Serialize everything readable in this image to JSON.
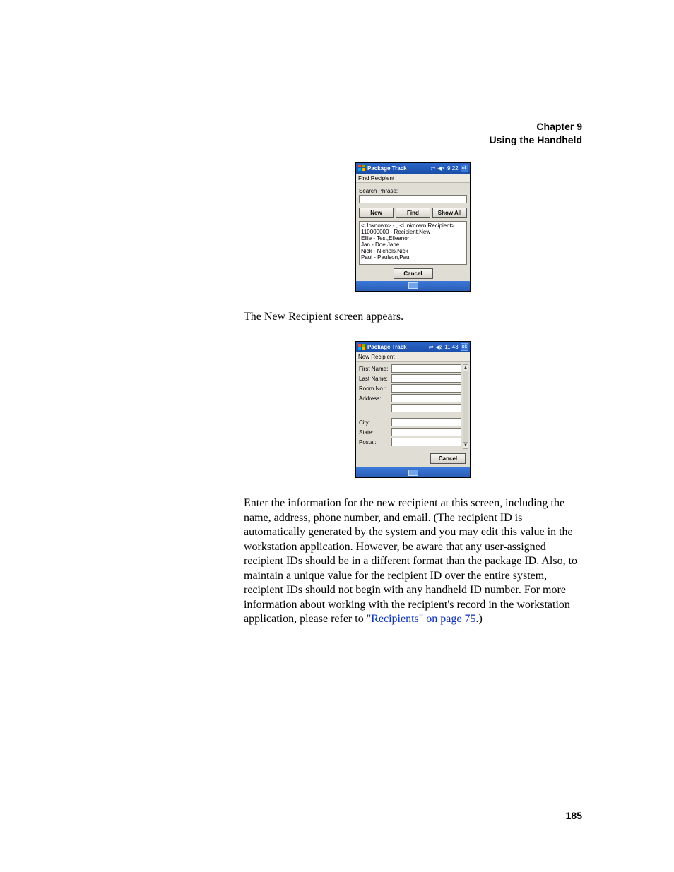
{
  "header": {
    "chapter": "Chapter 9",
    "title": "Using the Handheld"
  },
  "device1": {
    "titlebar": {
      "app": "Package Track",
      "time": "9:22",
      "ok": "ok"
    },
    "subhead": "Find Recipient",
    "search_label": "Search Phrase:",
    "buttons": {
      "new": "New",
      "find": "Find",
      "showall": "Show All"
    },
    "results": [
      "<Unknown> - , <Unknown Recipient>",
      "110000000 - Recipient,New",
      "Ellie - Test,Elleanor",
      "Jan - Doe,Jane",
      "Nick - Nichols,Nick",
      "Paul - Paulson,Paul"
    ],
    "cancel": "Cancel"
  },
  "caption1": "The New Recipient screen appears.",
  "device2": {
    "titlebar": {
      "app": "Package Track",
      "time": "11:43",
      "ok": "ok"
    },
    "subhead": "New Recipient",
    "fields": {
      "first": "First Name:",
      "last": "Last Name:",
      "room": "Room No.:",
      "address": "Address:",
      "city": "City:",
      "state": "State:",
      "postal": "Postal:"
    },
    "cancel": "Cancel"
  },
  "body_text": "Enter the information for the new recipient at this screen, including the name, address, phone number, and email. (The recipient ID is automatically generated by the system and you may edit this value in the workstation application. However, be aware that any user-assigned recipient IDs should be in a different format than the package ID. Also, to maintain a unique value for the recipient ID over the entire system, recipient IDs should not begin with any handheld ID number. For more information about working with the recipient's record in the workstation application, please refer to ",
  "link_text": "\"Recipients\" on page 75",
  "body_tail": ".)",
  "page_number": "185"
}
